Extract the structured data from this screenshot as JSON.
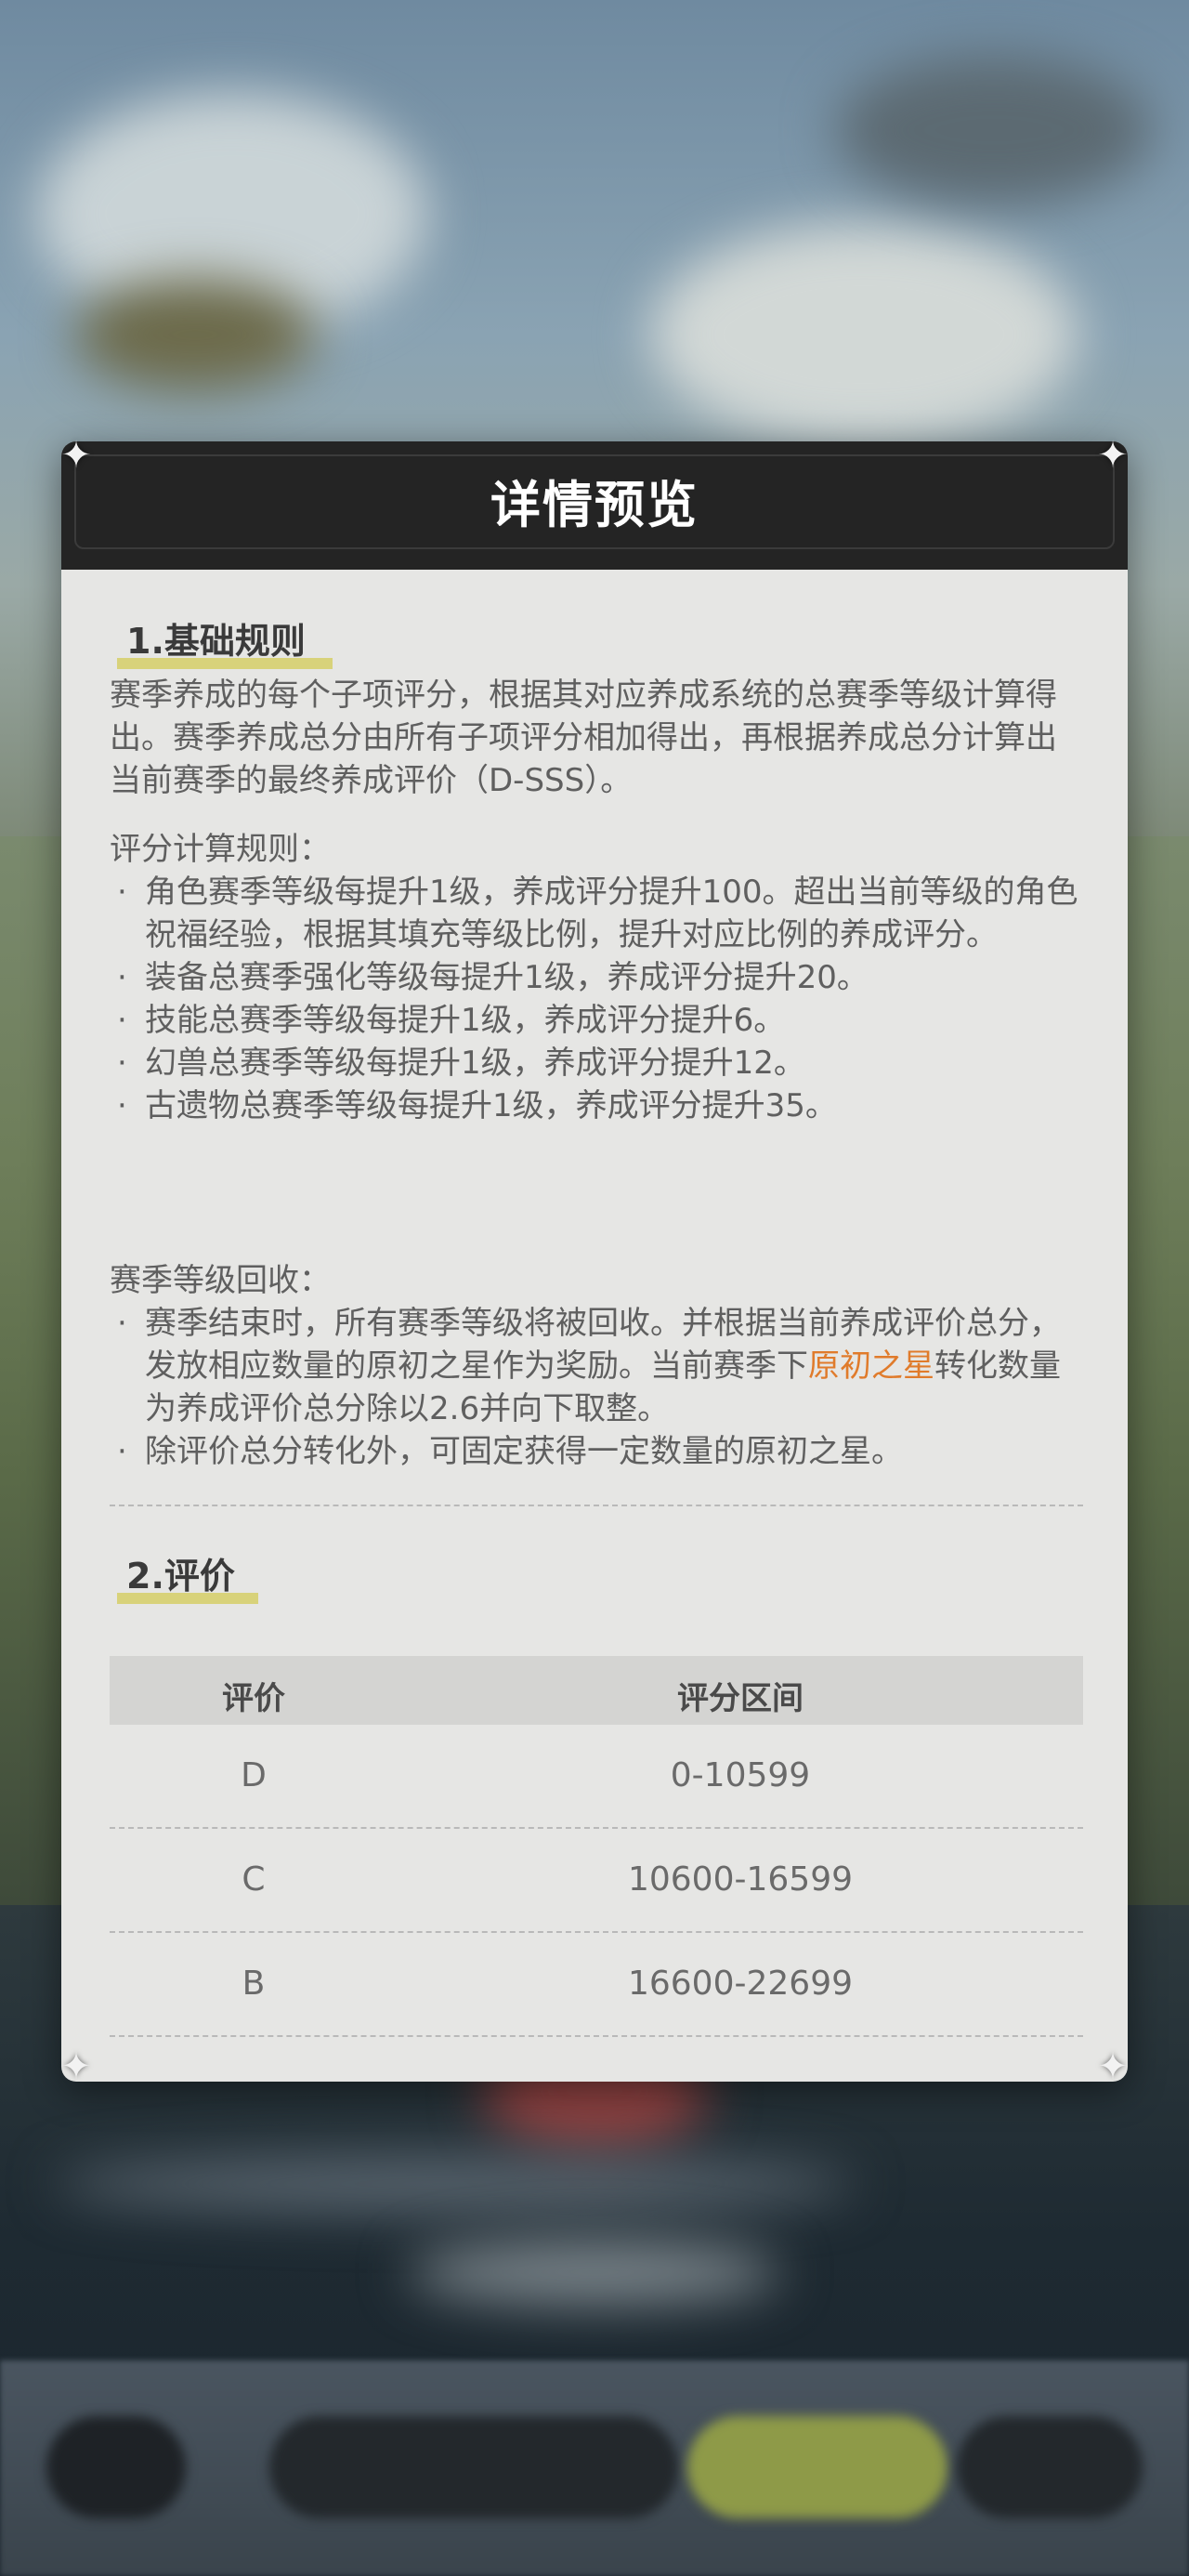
{
  "dialog": {
    "title": "详情预览",
    "section1": {
      "heading": "1.基础规则",
      "intro": "赛季养成的每个子项评分，根据其对应养成系统的总赛季等级计算得出。赛季养成总分由所有子项评分相加得出，再根据养成总分计算出当前赛季的最终养成评价（D-SSS）。",
      "rules_title": "评分计算规则：",
      "rules": [
        "角色赛季等级每提升1级，养成评分提升100。超出当前等级的角色祝福经验，根据其填充等级比例，提升对应比例的养成评分。",
        "装备总赛季强化等级每提升1级，养成评分提升20。",
        "技能总赛季等级每提升1级，养成评分提升6。",
        "幻兽总赛季等级每提升1级，养成评分提升12。",
        "古遗物总赛季等级每提升1级，养成评分提升35。"
      ],
      "recycle_title": "赛季等级回收：",
      "recycle_1_before": "赛季结束时，所有赛季等级将被回收。并根据当前养成评价总分，发放相应数量的原初之星作为奖励。当前赛季下",
      "recycle_1_highlight": "原初之星",
      "recycle_1_after": "转化数量为养成评价总分除以2.6并向下取整。",
      "recycle_2": "除评价总分转化外，可固定获得一定数量的原初之星。"
    },
    "section2": {
      "heading": "2.评价",
      "table": {
        "headers": [
          "评价",
          "评分区间"
        ],
        "rows": [
          [
            "D",
            "0-10599"
          ],
          [
            "C",
            "10600-16599"
          ],
          [
            "B",
            "16600-22699"
          ]
        ]
      }
    }
  },
  "colors": {
    "accent": "#e07b2b",
    "heading_highlight": "#d8d27a",
    "header_bg": "#242424",
    "panel_bg": "#e6e6e4"
  },
  "icons": [
    "corner-ornament-icon"
  ]
}
